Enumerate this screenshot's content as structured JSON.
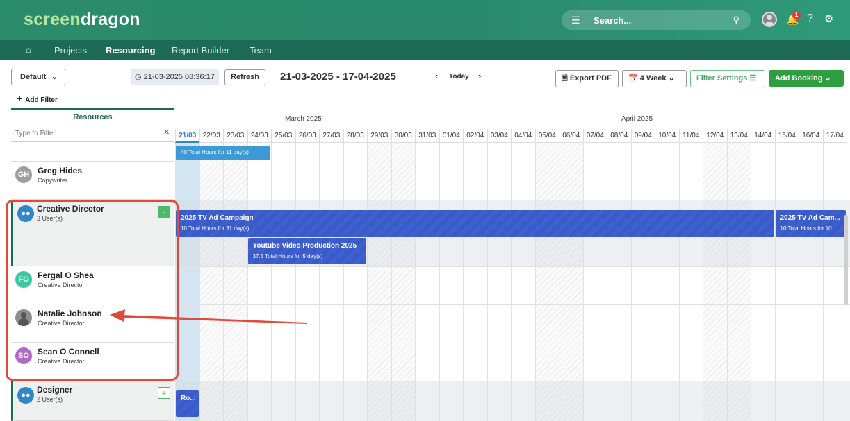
{
  "header": {
    "logo_part1": "screen",
    "logo_part2": "dragon",
    "search_placeholder": "Search...",
    "notification_count": "1"
  },
  "nav": {
    "items": [
      {
        "label": "Projects"
      },
      {
        "label": "Resourcing"
      },
      {
        "label": "Report Builder"
      },
      {
        "label": "Team"
      }
    ],
    "active": "Resourcing"
  },
  "toolbar": {
    "view_select": "Default",
    "timestamp": "21-03-2025 08:36:17",
    "refresh_label": "Refresh",
    "date_range": "21-03-2025 - 17-04-2025",
    "today_label": "Today",
    "export_label": "Export PDF",
    "period_label": "4 Week",
    "filter_settings_label": "Filter Settings",
    "add_booking_label": "Add Booking",
    "add_filter_label": "Add Filter"
  },
  "resources_panel": {
    "title": "Resources",
    "filter_placeholder": "Type to Filter",
    "rows": [
      {
        "initials": "GH",
        "name": "Greg Hides",
        "role": "Copywriter",
        "color": "#9e9e9e"
      },
      {
        "initials": "",
        "name": "Creative Director",
        "role": "3 User(s)",
        "color": "#2f86c8",
        "group": true,
        "toggle": "-"
      },
      {
        "initials": "FO",
        "name": "Fergal O Shea",
        "role": "Creative Director",
        "color": "#3cc8a0"
      },
      {
        "initials": "",
        "name": "Natalie Johnson",
        "role": "Creative Director",
        "color": "#8d8d8d"
      },
      {
        "initials": "SO",
        "name": "Sean O Connell",
        "role": "Creative Director",
        "color": "#b06ac8"
      },
      {
        "initials": "",
        "name": "Designer",
        "role": "2 User(s)",
        "color": "#2f86c8",
        "group": true,
        "toggle": "+"
      }
    ]
  },
  "calendar": {
    "months": [
      "March 2025",
      "April 2025"
    ],
    "days": [
      "21/03",
      "22/03",
      "23/03",
      "24/03",
      "25/03",
      "26/03",
      "27/03",
      "28/03",
      "29/03",
      "30/03",
      "31/03",
      "01/04",
      "02/04",
      "03/04",
      "04/04",
      "05/04",
      "06/04",
      "07/04",
      "08/04",
      "09/04",
      "10/04",
      "11/04",
      "12/04",
      "13/04",
      "14/04",
      "15/04",
      "16/04",
      "17/04"
    ],
    "weekend_indices": [
      1,
      2,
      8,
      9,
      15,
      16,
      22,
      23
    ],
    "today_index": 0,
    "bookings": [
      {
        "title": "",
        "subtitle": "40 Total Hours for 11 day(s)",
        "start_day": "21/03",
        "end_day": "24/03",
        "row": "Greg Hides",
        "color": "#3d9ad6"
      },
      {
        "title": "2025 TV Ad Campaign",
        "subtitle": "10 Total Hours for 31 day(s)",
        "start_day": "21/03",
        "end_day": "14/04",
        "row": "Creative Director"
      },
      {
        "title": "2025 TV Ad Cam...",
        "subtitle": "10 Total Hours for 10 ...",
        "start_day": "15/04",
        "end_day": "17/04",
        "row": "Creative Director"
      },
      {
        "title": "Youtube Video Production 2025",
        "subtitle": "37.5 Total Hours for 5 day(s)",
        "start_day": "24/03",
        "end_day": "28/03",
        "row": "Creative Director"
      },
      {
        "title": "Ro...",
        "subtitle": "",
        "start_day": "21/03",
        "end_day": "21/03",
        "row": "Designer"
      }
    ]
  }
}
